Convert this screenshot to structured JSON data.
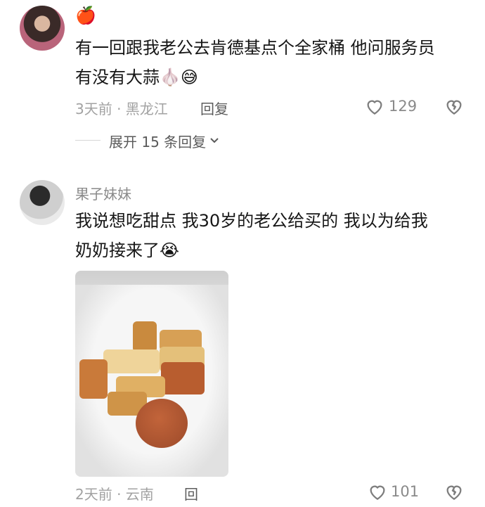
{
  "comments": [
    {
      "username_emoji": "🍎",
      "text_line1": "有一回跟我老公去肯德基点个全家桶 他问服务员",
      "text_line2": "有没有大蒜🧄😅",
      "time_location": "3天前 · 黑龙江",
      "reply_label": "回复",
      "likes": "129"
    },
    {
      "username": "果子妹妹",
      "text_line1": "我说想吃甜点  我30岁的老公给买的 我以为给我",
      "text_line2": "奶奶接来了😭",
      "time_location": "2天前 · 云南",
      "reply_label": "回",
      "likes": "101"
    }
  ],
  "expand_replies": {
    "label": "展开 15 条回复"
  },
  "icons": {
    "like": "heart-outline-icon",
    "dislike": "broken-heart-icon",
    "expand": "chevron-down-icon"
  },
  "colors": {
    "text": "#161616",
    "meta": "#a2a2a2",
    "username": "#8a8a8a"
  }
}
